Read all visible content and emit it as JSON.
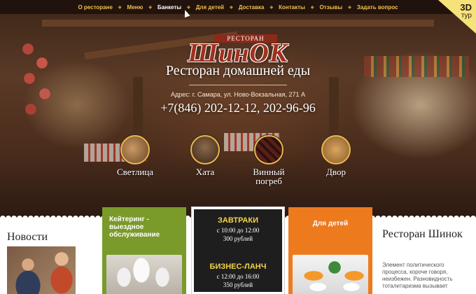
{
  "nav": {
    "items": [
      {
        "label": "О ресторане"
      },
      {
        "label": "Меню"
      },
      {
        "label": "Банкеты"
      },
      {
        "label": "Для детей"
      },
      {
        "label": "Доставка"
      },
      {
        "label": "Контакты"
      },
      {
        "label": "Отзывы"
      },
      {
        "label": "Задать вопрос"
      }
    ],
    "active_index": 2
  },
  "tour": {
    "big": "3D",
    "small": "тур"
  },
  "logo": {
    "small": "РЕСТОРАН",
    "name": "ШинОК"
  },
  "hero": {
    "tagline": "Ресторан домашней еды",
    "address": "Адрес: г. Самара, ул. Ново-Вокзальная, 271 А",
    "phone": "+7(846) 202-12-12, 202-96-96"
  },
  "halls": [
    {
      "label": "Светлица"
    },
    {
      "label": "Хата"
    },
    {
      "label": "Винный погреб"
    },
    {
      "label": "Двор"
    }
  ],
  "news": {
    "title": "Новости"
  },
  "cards": {
    "catering": {
      "title": "Кейтеринг - выездное обслуживание"
    },
    "meals": {
      "breakfast_title": "ЗАВТРАКИ",
      "breakfast_time": "с 10:00 до 12:00",
      "breakfast_price": "300 рублей",
      "lunch_title": "БИЗНЕС-ЛАНЧ",
      "lunch_time": "с 12:00 до 16:00",
      "lunch_price": "350 рублей"
    },
    "kids": {
      "title": "Для детей"
    }
  },
  "about": {
    "title": "Ресторан Шинок",
    "text": "Элемент политического процесса, короче говоря, неизбежен. Разновидность тоталитаризма вызывает"
  },
  "colors": {
    "nav_text": "#f0c14b",
    "accent_gold": "#e9b84a",
    "catering_green": "#7a9a2a",
    "kids_orange": "#ee7a1e",
    "meal_yellow": "#f3d44a",
    "logo_red": "#a0301d"
  }
}
